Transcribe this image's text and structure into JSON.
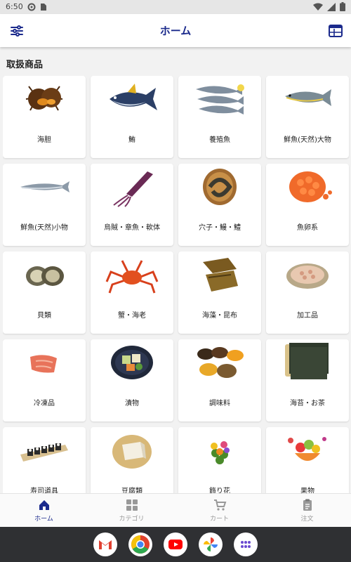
{
  "status": {
    "time": "6:50"
  },
  "header": {
    "title": "ホーム"
  },
  "section": {
    "title": "取扱商品"
  },
  "categories": [
    {
      "label": "海胆",
      "icon": "sea-urchin"
    },
    {
      "label": "鮪",
      "icon": "tuna"
    },
    {
      "label": "養殖魚",
      "icon": "farmed-fish"
    },
    {
      "label": "鮮魚(天然)大物",
      "icon": "large-fish"
    },
    {
      "label": "鮮魚(天然)小物",
      "icon": "small-fish"
    },
    {
      "label": "烏賊・章魚・軟体",
      "icon": "squid"
    },
    {
      "label": "穴子・鰻・鱧",
      "icon": "eel"
    },
    {
      "label": "魚卵系",
      "icon": "fish-roe"
    },
    {
      "label": "貝類",
      "icon": "abalone"
    },
    {
      "label": "蟹・海老",
      "icon": "crab"
    },
    {
      "label": "海藻・昆布",
      "icon": "kelp"
    },
    {
      "label": "加工品",
      "icon": "processed-food"
    },
    {
      "label": "冷凍品",
      "icon": "frozen-fish"
    },
    {
      "label": "漬物",
      "icon": "pickles"
    },
    {
      "label": "調味料",
      "icon": "seasoning"
    },
    {
      "label": "海苔・お茶",
      "icon": "nori"
    },
    {
      "label": "寿司道具",
      "icon": "sushi-tools"
    },
    {
      "label": "豆腐類",
      "icon": "tofu"
    },
    {
      "label": "飾り花",
      "icon": "flowers"
    },
    {
      "label": "果物",
      "icon": "fruit"
    }
  ],
  "nav": {
    "items": [
      {
        "label": "ホーム",
        "icon": "home-icon",
        "active": true
      },
      {
        "label": "カテゴリ",
        "icon": "grid-icon",
        "active": false
      },
      {
        "label": "カート",
        "icon": "cart-icon",
        "active": false
      },
      {
        "label": "注文",
        "icon": "clipboard-icon",
        "active": false
      }
    ]
  },
  "dock": {
    "apps": [
      "gmail-icon",
      "chrome-icon",
      "youtube-icon",
      "photos-icon",
      "app-drawer-icon"
    ]
  },
  "colors": {
    "accent": "#1b2a8c",
    "inactive": "#999999"
  }
}
